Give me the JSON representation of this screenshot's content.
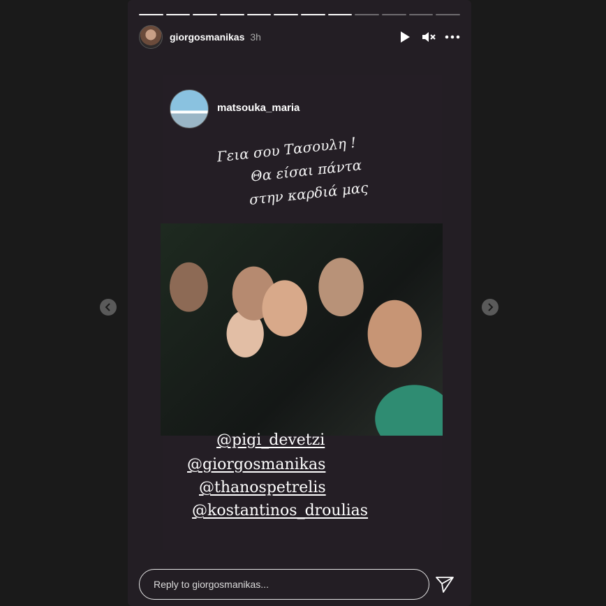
{
  "story": {
    "progress": {
      "total": 12,
      "completed": 8
    },
    "author": "giorgosmanikas",
    "time": "3h",
    "icons": {
      "play": "play-icon",
      "mute": "mute-icon",
      "more": "more-icon"
    }
  },
  "shared_post": {
    "author": "matsouka_maria",
    "caption": [
      "Γεια σου Τασουλη !",
      "Θα είσαι πάντα",
      "στην καρδιά μας"
    ],
    "mentions": [
      "@pigi_devetzi",
      "@giorgosmanikas",
      "@thanospetrelis",
      "@kostantinos_droulias"
    ]
  },
  "reply": {
    "placeholder": "Reply to giorgosmanikas..."
  },
  "navigation": {
    "prev_icon": "chevron-left-icon",
    "next_icon": "chevron-right-icon"
  }
}
